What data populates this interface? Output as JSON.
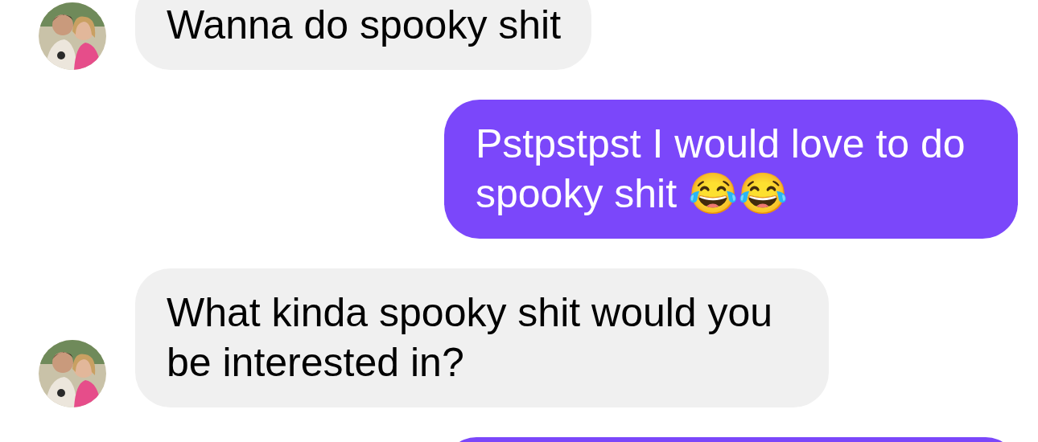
{
  "messages": [
    {
      "kind": "received",
      "text": "Wanna do spooky shit",
      "avatar": true
    },
    {
      "kind": "sent",
      "text": "Pstpstpst I would love to do spooky shit 😂😂"
    },
    {
      "kind": "received",
      "text": "What kinda spooky shit would you be interested in?",
      "avatar": true
    },
    {
      "kind": "sent"
    }
  ]
}
